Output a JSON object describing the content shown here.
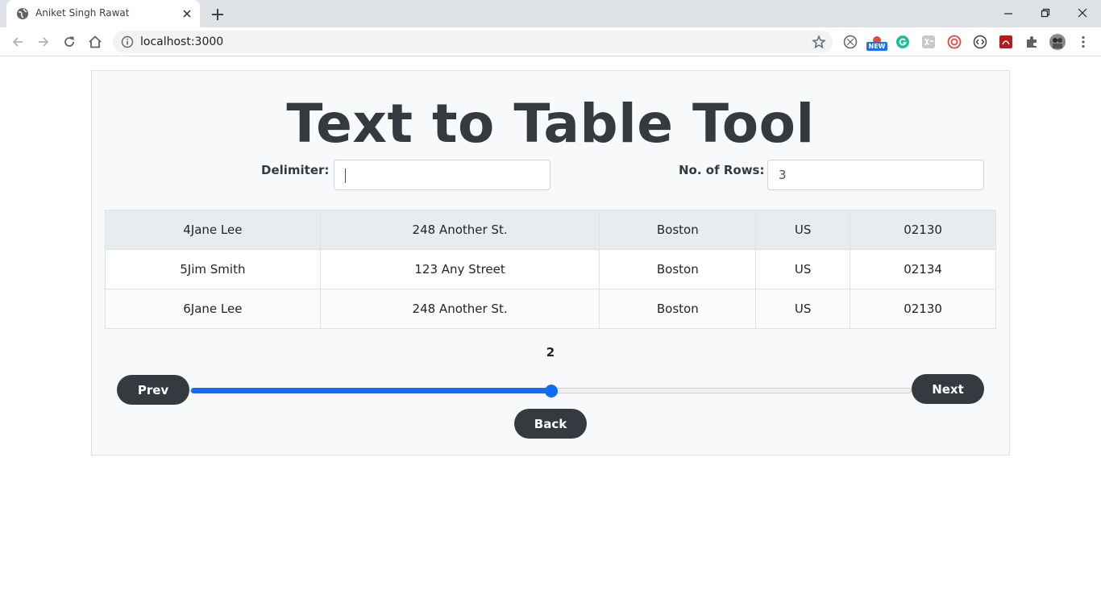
{
  "browser": {
    "tab_title": "Aniket Singh Rawat",
    "url": "localhost:3000",
    "extensions": [
      "github-icon",
      "new-badge-icon",
      "grammarly-icon",
      "translate-icon",
      "circle-extension-icon",
      "code-icon",
      "pdf-icon",
      "puzzle-icon",
      "profile-avatar"
    ],
    "new_badge": "NEW"
  },
  "page": {
    "title": "Text to Table Tool",
    "delimiter_label": "Delimiter:",
    "delimiter_value": "",
    "rows_label": "No. of Rows:",
    "rows_value": "3",
    "table": {
      "rows": [
        [
          "4Jane Lee",
          "248 Another St.",
          "Boston",
          "US",
          "02130"
        ],
        [
          "5Jim Smith",
          "123 Any Street",
          "Boston",
          "US",
          "02134"
        ],
        [
          "6Jane Lee",
          "248 Another St.",
          "Boston",
          "US",
          "02130"
        ]
      ]
    },
    "page_number": "2",
    "slider_fraction": 0.5,
    "prev_label": "Prev",
    "next_label": "Next",
    "back_label": "Back"
  },
  "colors": {
    "accent": "#0d6efd",
    "dark": "#343a40"
  }
}
